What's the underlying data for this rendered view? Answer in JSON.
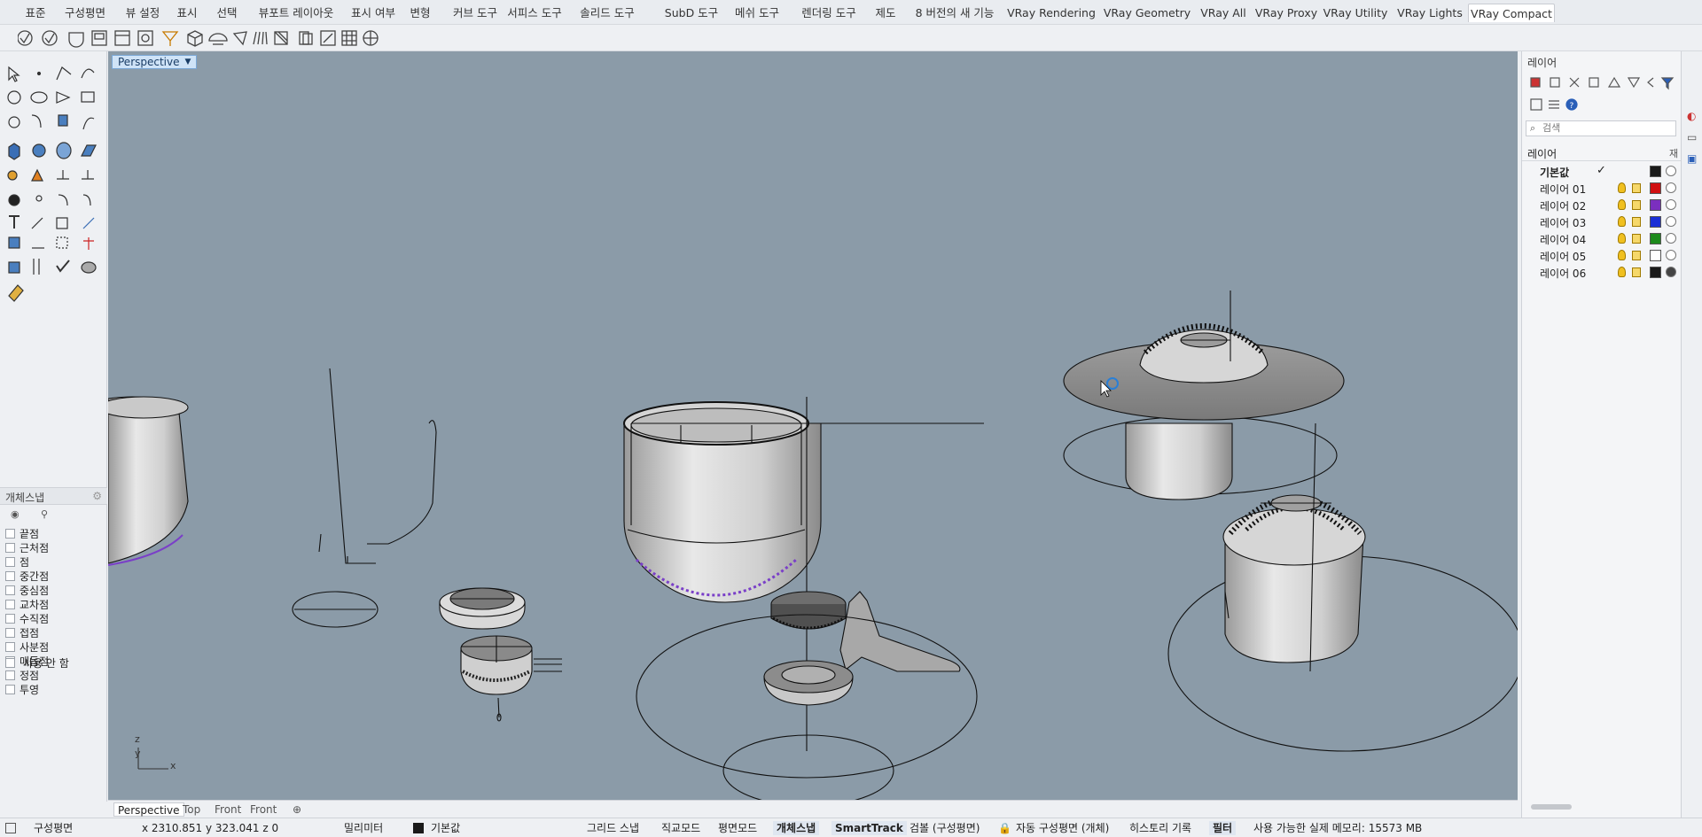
{
  "menu_tabs": [
    "표준",
    "구성평면",
    "뷰 설정",
    "표시",
    "선택",
    "뷰포트 레이아웃",
    "표시 여부",
    "변형",
    "커브 도구",
    "서피스 도구",
    "솔리드 도구",
    "SubD 도구",
    "메쉬 도구",
    "렌더링 도구",
    "제도",
    "8 버전의 새 기능",
    "VRay Rendering",
    "VRay Geometry",
    "VRay All",
    "VRay Proxy",
    "VRay Utility",
    "VRay Lights",
    "VRay Compact"
  ],
  "active_tab": "VRay Compact",
  "viewport": {
    "label": "Perspective"
  },
  "osnap": {
    "title": "개체스냅",
    "items": [
      "끝점",
      "근처점",
      "점",
      "중간점",
      "중심점",
      "교차점",
      "수직점",
      "접점",
      "사분점",
      "매듭점",
      "정점",
      "투영"
    ],
    "disable_label": "사용 안 함"
  },
  "view_tabs": [
    "Perspective",
    "Top",
    "Front",
    "Front"
  ],
  "layers": {
    "title": "레이어",
    "search_placeholder": "검색",
    "column_header": "레이어",
    "column_short": "재",
    "rows": [
      {
        "name": "기본값",
        "color": "#1a1a1a",
        "current": true
      },
      {
        "name": "레이어 01",
        "color": "#d01010"
      },
      {
        "name": "레이어 02",
        "color": "#7b2fbf"
      },
      {
        "name": "레이어 03",
        "color": "#1a2fd6"
      },
      {
        "name": "레이어 04",
        "color": "#1c8a1c"
      },
      {
        "name": "레이어 05",
        "color": "#ffffff"
      },
      {
        "name": "레이어 06",
        "color": "#1a1a1a",
        "mat_filled": true
      }
    ],
    "check_mark": "✓"
  },
  "status": {
    "cplane": "구성평면",
    "coords": "x 2310.851   y 323.041   z 0",
    "units": "밀리미터",
    "layer": "기본값",
    "grid_snap": "그리드 스냅",
    "ortho": "직교모드",
    "planar": "평면모드",
    "osnap": "개체스냅",
    "smarttrack": "SmartTrack",
    "gumball": "검볼 (구성평면)",
    "auto_cplane": "자동 구성평면 (개체)",
    "history": "히스토리 기록",
    "filter": "필터",
    "memory": "사용 가능한 실제 메모리: 15573 MB"
  },
  "axis": {
    "x": "x",
    "y": "y",
    "z": "z"
  }
}
